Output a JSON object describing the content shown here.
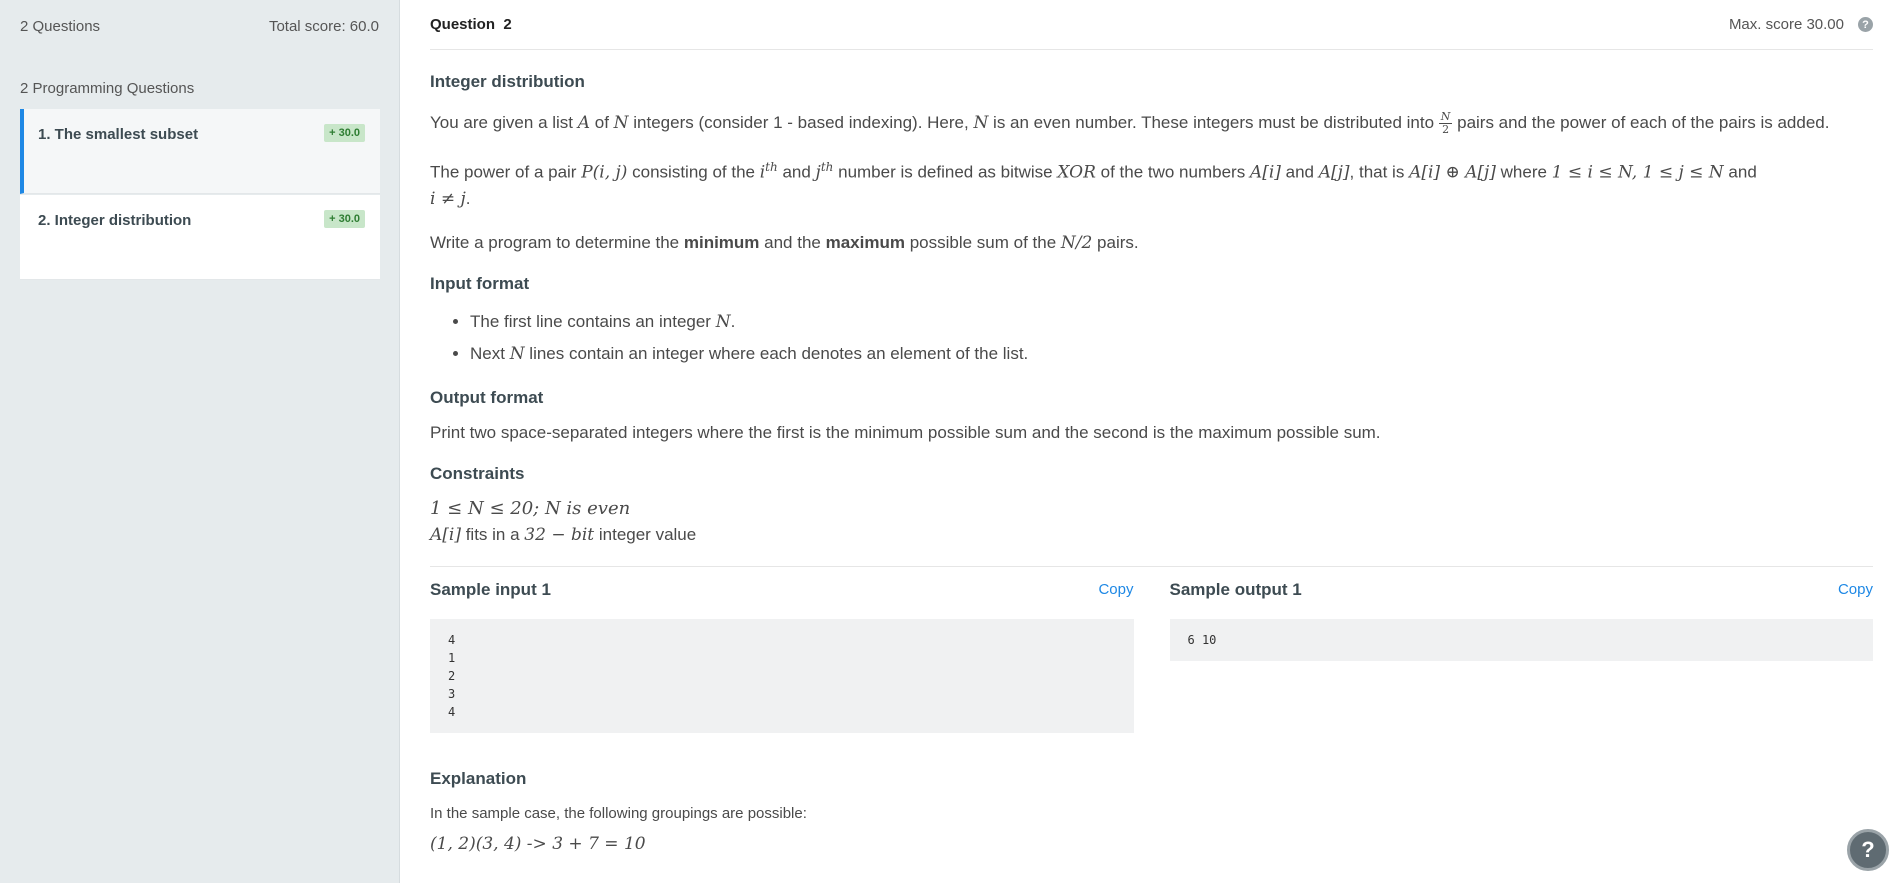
{
  "sidebar": {
    "questions_count": "2 Questions",
    "total_score": "Total score: 60.0",
    "section_title": "2 Programming Questions",
    "items": [
      {
        "label": "1. The smallest subset",
        "badge": "+ 30.0"
      },
      {
        "label": "2. Integer distribution",
        "badge": "+ 30.0"
      }
    ]
  },
  "header": {
    "question_label": "Question",
    "question_number": "2",
    "max_score": "Max. score 30.00",
    "help_icon": "question-circle-icon"
  },
  "problem": {
    "title": "Integer distribution",
    "p1": {
      "t1": "You are given a list ",
      "A": "A",
      "t2": " of ",
      "N": "N",
      "t3": " integers (consider 1 - based indexing). Here, ",
      "N2": "N",
      "t4": " is an even number. These integers must be distributed into ",
      "frac_num": "N",
      "frac_den": "2",
      "t5": " pairs and the power of each of the pairs is added."
    },
    "p2": {
      "t1": "The power of a pair ",
      "pair": "P(i, j)",
      "t2": " consisting of the ",
      "i": "i",
      "th1": "th",
      "t3": " and ",
      "j": "j",
      "th2": "th",
      "t4": " number is defined as bitwise ",
      "xor": "XOR",
      "t5": " of the two numbers ",
      "Ai": "A[i]",
      "t6": " and ",
      "Aj": "A[j]",
      "t7": ", that is ",
      "expr": "A[i] ⊕ A[j]",
      "t8": " where ",
      "c1": "1 ≤ i ≤ N,  1 ≤ j ≤ N",
      "t9": " and",
      "c2": "i ≠ j",
      "t10": "."
    },
    "p3": {
      "t1": "Write a program to determine the ",
      "min": "minimum",
      "t2": " and the ",
      "max": "maximum",
      "t3": " possible sum of the ",
      "n2": "N/2",
      "t4": " pairs."
    },
    "input_format_title": "Input format",
    "input_bullets": [
      {
        "t1": "The first line contains an integer ",
        "m": "N",
        "t2": "."
      },
      {
        "t1": "Next ",
        "m": "N",
        "t2": " lines contain an integer where each denotes an element of the list."
      }
    ],
    "output_format_title": "Output format",
    "output_text": "Print two space-separated integers where the first is the minimum possible sum and the second is the maximum possible sum.",
    "constraints_title": "Constraints",
    "constraint1": "1 ≤ N ≤ 20;  N is even",
    "constraint2": {
      "m1": "A[i]",
      "t1": " fits in a ",
      "m2": "32 − bit",
      "t2": " integer value"
    }
  },
  "samples": {
    "input_title": "Sample input 1",
    "output_title": "Sample output 1",
    "copy_label": "Copy",
    "input_code": "4\n1\n2\n3\n4",
    "output_code": "6 10"
  },
  "explanation": {
    "title": "Explanation",
    "text": "In the sample case, the following groupings are possible:",
    "math": "(1, 2)(3, 4) -> 3 + 7 = 10"
  },
  "float_help": "?"
}
